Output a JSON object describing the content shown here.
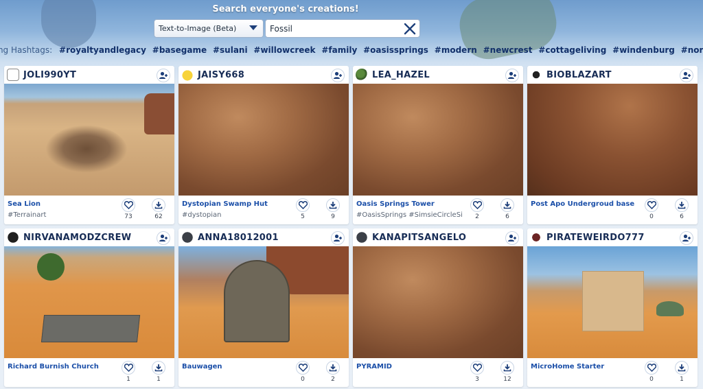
{
  "search": {
    "title": "Search everyone's creations!",
    "type_selected": "Text-to-Image (Beta)",
    "query": "Fossil"
  },
  "hashtags": {
    "label": "ding Hashtags:",
    "tags": [
      "#royaltyandlegacy",
      "#basegame",
      "#sulani",
      "#willowcreek",
      "#family",
      "#oasissprings",
      "#modern",
      "#newcrest",
      "#cottageliving",
      "#windenburg",
      "#nordhaven"
    ]
  },
  "colors": {
    "accent": "#1b4fa8",
    "username": "#172c55",
    "icon_blue": "#1d3f7a",
    "sand": "#e0964a",
    "rock": "#8a5a3a"
  },
  "cards": [
    {
      "user": "JOLI990YT",
      "avatar_icon": "cartoon-logo-icon",
      "title": "Sea Lion",
      "desc": "#Terrainart",
      "likes": "73",
      "downloads": "62",
      "scene": "fossil-art"
    },
    {
      "user": "JAISY668",
      "avatar_icon": "chick-icon",
      "title": "Dystopian Swamp Hut",
      "desc": "#dystopian",
      "likes": "5",
      "downloads": "9",
      "scene": "rock-closeup"
    },
    {
      "user": "LEA_HAZEL",
      "avatar_icon": "plant-icon",
      "title": "Oasis Springs Tower",
      "desc": "#OasisSprings #SimsieCircleSi",
      "likes": "2",
      "downloads": "6",
      "scene": "rock-closeup"
    },
    {
      "user": "BIOBLAZART",
      "avatar_icon": "panda-icon",
      "title": "Post Apo Undergroud base",
      "desc": "",
      "likes": "0",
      "downloads": "6",
      "scene": "rock-dark"
    },
    {
      "user": "NIRVANAMODZCREW",
      "avatar_icon": "smiley-icon",
      "title": "Richard Burnish Church",
      "desc": "",
      "likes": "1",
      "downloads": "1",
      "scene": "slab"
    },
    {
      "user": "ANNA18012001",
      "avatar_icon": "default-avatar-icon",
      "title": "Bauwagen",
      "desc": "",
      "likes": "0",
      "downloads": "2",
      "scene": "wagon"
    },
    {
      "user": "KANAPITSANGELO",
      "avatar_icon": "default-avatar-icon",
      "title": "PYRAMID",
      "desc": "",
      "likes": "3",
      "downloads": "12",
      "scene": "rock-closeup"
    },
    {
      "user": "PIRATEWEIRDO777",
      "avatar_icon": "pirate-flag-icon",
      "title": "MicroHome Starter",
      "desc": "",
      "likes": "0",
      "downloads": "1",
      "scene": "microhome"
    }
  ]
}
